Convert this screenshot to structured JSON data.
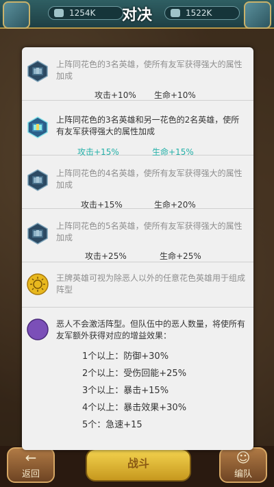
{
  "top": {
    "title": "对决",
    "score_left": "1254K",
    "score_right": "1522K"
  },
  "bonuses": [
    {
      "desc": "上阵同花色的3名英雄，使所有友军获得强大的属性加成",
      "stat1": "攻击+10%",
      "stat2": "生命+10%",
      "active": false
    },
    {
      "desc": "上阵同花色的3名英雄和另一花色的2名英雄，使所有友军获得强大的属性加成",
      "stat1": "攻击+15%",
      "stat2": "生命+15%",
      "active": true
    },
    {
      "desc": "上阵同花色的4名英雄，使所有友军获得强大的属性加成",
      "stat1": "攻击+15%",
      "stat2": "生命+20%",
      "active": false
    },
    {
      "desc": "上阵同花色的5名英雄，使所有友军获得强大的属性加成",
      "stat1": "攻击+25%",
      "stat2": "生命+25%",
      "active": false
    }
  ],
  "king": {
    "desc": "王牌英雄可视为除恶人以外的任意花色英雄用于组成阵型"
  },
  "villain": {
    "desc": "恶人不会激活阵型。但队伍中的恶人数量，将使所有友军额外获得对应的增益效果：",
    "items": [
      "1个以上：防御+30%",
      "2个以上：受伤回能+25%",
      "3个以上：暴击+15%",
      "4个以上：暴击效果+30%",
      "5个：急速+15"
    ]
  },
  "bottom": {
    "back_label": "返回",
    "fight_label": "战斗",
    "team_label": "编队"
  },
  "colors": {
    "active_stat": "#22b0a8",
    "panel_bg": "#f0f0f0",
    "fight_button": "#f3d24e"
  }
}
